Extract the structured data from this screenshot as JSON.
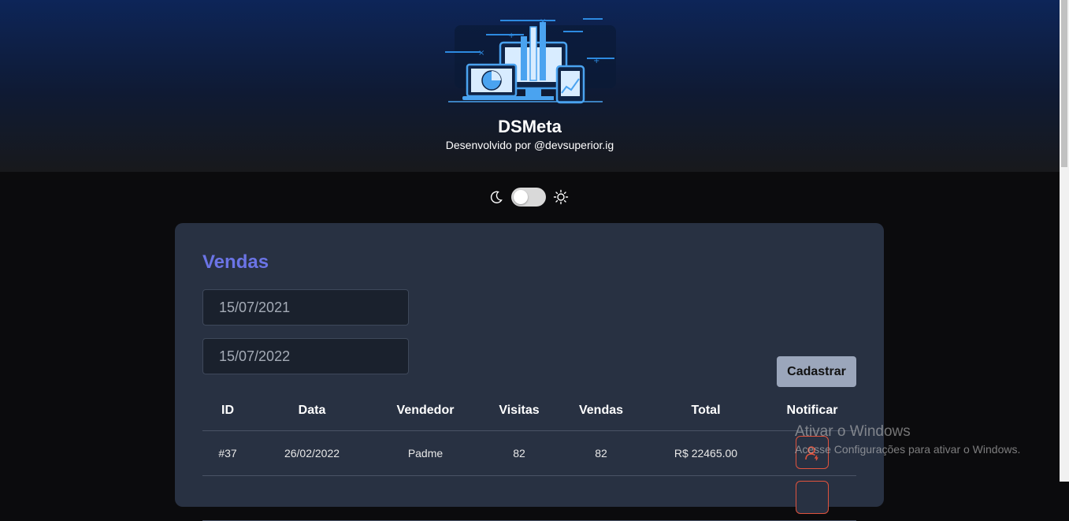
{
  "header": {
    "title": "DSMeta",
    "subtitle": "Desenvolvido por @devsuperior.ig",
    "logo_icon": "dashboard-analytics-illustration"
  },
  "theme_toggle": {
    "left_icon": "moon-icon",
    "right_icon": "sun-icon",
    "state": "off"
  },
  "sales": {
    "title": "Vendas",
    "min_date": "15/07/2021",
    "max_date": "15/07/2022",
    "register_button": "Cadastrar",
    "columns": [
      "ID",
      "Data",
      "Vendedor",
      "Visitas",
      "Vendas",
      "Total",
      "Notificar"
    ],
    "rows": [
      {
        "id": "#37",
        "date": "26/02/2022",
        "seller": "Padme",
        "visits": "82",
        "sales": "82",
        "total": "R$ 22465.00"
      }
    ]
  },
  "windows_watermark": {
    "title": "Ativar o Windows",
    "message": "Acesse Configurações para ativar o Windows."
  },
  "colors": {
    "accent": "#6b74e6",
    "card_bg": "#283142",
    "notify_border": "#e0533d"
  }
}
